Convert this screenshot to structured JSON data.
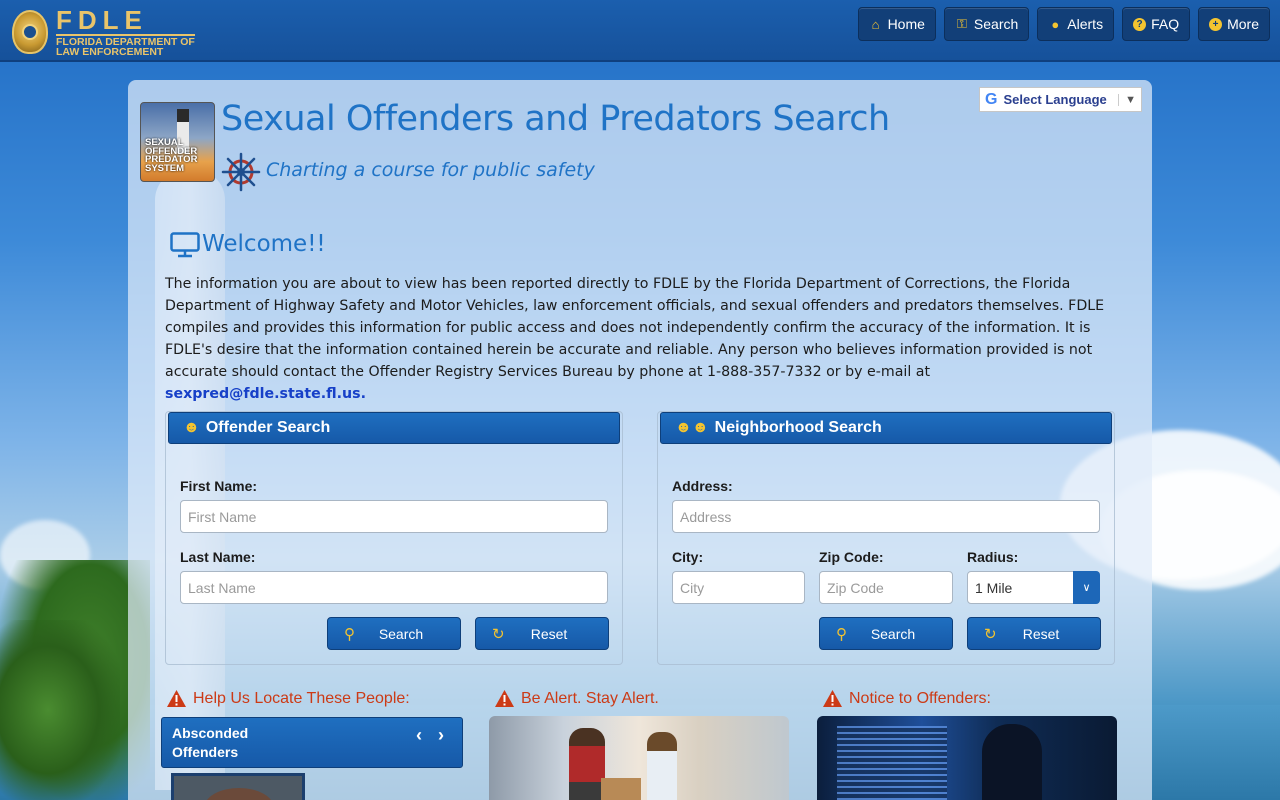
{
  "header": {
    "logo_title": "FDLE",
    "logo_subtitle_line1": "FLORIDA DEPARTMENT OF",
    "logo_subtitle_line2": "LAW ENFORCEMENT",
    "nav": [
      {
        "label": "Home",
        "icon": "home-icon"
      },
      {
        "label": "Search",
        "icon": "key-icon"
      },
      {
        "label": "Alerts",
        "icon": "bell-icon"
      },
      {
        "label": "FAQ",
        "icon": "question-icon"
      },
      {
        "label": "More",
        "icon": "plus-icon"
      }
    ]
  },
  "translate": {
    "label": "Select Language"
  },
  "system_logo": {
    "line1": "SEXUAL",
    "line2": "OFFENDER",
    "line3": "PREDATOR",
    "line4": "SYSTEM"
  },
  "page": {
    "title": "Sexual Offenders and Predators Search",
    "tagline": "Charting a course for public safety"
  },
  "welcome": {
    "heading": "Welcome!!",
    "text": "The information you are about to view has been reported directly to FDLE by the Florida Department of Corrections, the Florida Department of Highway Safety and Motor Vehicles, law enforcement officials, and sexual offenders and predators themselves. FDLE compiles and provides this information for public access and does not independently confirm the accuracy of the information. It is FDLE's desire that the information contained herein be accurate and reliable. Any person who believes information provided is not accurate should contact the Offender Registry Services Bureau by phone at ",
    "phone": "1-888-357-7332",
    "email_prefix": " or by e-mail at ",
    "email": "sexpred@fdle.state.fl.us."
  },
  "offender_search": {
    "heading": "Offender Search",
    "first_name_label": "First Name:",
    "first_name_placeholder": "First Name",
    "last_name_label": "Last Name:",
    "last_name_placeholder": "Last Name",
    "search_label": "Search",
    "reset_label": "Reset"
  },
  "neighborhood_search": {
    "heading": "Neighborhood Search",
    "address_label": "Address:",
    "address_placeholder": "Address",
    "city_label": "City:",
    "city_placeholder": "City",
    "zip_label": "Zip Code:",
    "zip_placeholder": "Zip Code",
    "radius_label": "Radius:",
    "radius_value": "1 Mile",
    "search_label": "Search",
    "reset_label": "Reset"
  },
  "sections": {
    "locate_heading": "Help Us Locate These People:",
    "alert_heading": "Be Alert. Stay Alert.",
    "notice_heading": "Notice to Offenders:",
    "absconded_line1": "Absconded",
    "absconded_line2": "Offenders"
  },
  "colors": {
    "brand_blue": "#1f73c6",
    "nav_bg": "#16519a",
    "accent_gold": "#e9c46a",
    "warning_red": "#cc3a16"
  }
}
